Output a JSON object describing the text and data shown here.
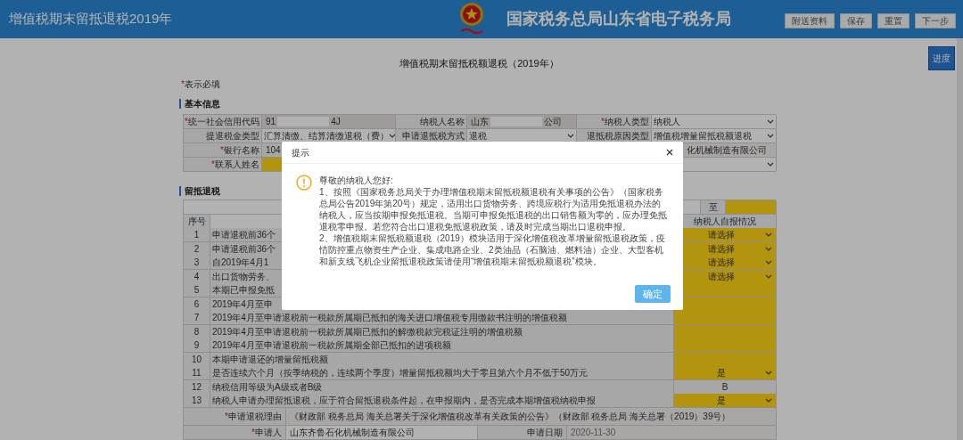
{
  "header": {
    "title": "增值税期末留抵退税2019年",
    "site_name": "国家税务总局山东省电子税务局",
    "buttons": [
      "附送资料",
      "保存",
      "重置",
      "下一步"
    ]
  },
  "page_title": "增值税期末留抵税额退税（2019年）",
  "progress_button": "进度",
  "required_note": {
    "mark": "*",
    "text": "表示必填"
  },
  "basic_info": {
    "title": "基本信息",
    "rows": [
      [
        {
          "kind": "label",
          "mark": "*",
          "text": "统一社会信用代码"
        },
        {
          "kind": "masked",
          "prefix": "91",
          "suffix": "4J"
        },
        {
          "kind": "label",
          "text": "纳税人名称"
        },
        {
          "kind": "masked",
          "prefix": "山东",
          "suffix": "公司"
        },
        {
          "kind": "label",
          "mark": "*",
          "text": "纳税人类型"
        },
        {
          "kind": "select",
          "text": "纳税人"
        }
      ],
      [
        {
          "kind": "label",
          "text": "提退税金类型"
        },
        {
          "kind": "select",
          "text": "汇算清缴、结算清缴退税（费）"
        },
        {
          "kind": "label",
          "text": "申请退抵税方式"
        },
        {
          "kind": "select",
          "text": "退税"
        },
        {
          "kind": "label",
          "text": "退抵税原因类型"
        },
        {
          "kind": "select",
          "text": "增值税增量留抵税额退税"
        }
      ],
      [
        {
          "kind": "label",
          "mark": "*",
          "text": "银行名称"
        },
        {
          "kind": "value",
          "text": "104"
        },
        {
          "kind": "blank"
        },
        {
          "kind": "blank"
        },
        {
          "kind": "blank"
        },
        {
          "kind": "value_tail",
          "text": "化机械制造有限公司"
        }
      ],
      [
        {
          "kind": "label",
          "mark": "*",
          "text": "联系人姓名"
        },
        {
          "kind": "input"
        },
        {
          "kind": "blank"
        },
        {
          "kind": "blank"
        },
        {
          "kind": "blank"
        },
        {
          "kind": "select"
        }
      ]
    ]
  },
  "refund": {
    "title": "留抵退税",
    "period_to": "至",
    "columns": [
      "序号",
      "纳税人自报情况"
    ],
    "rows": [
      {
        "no": "1",
        "text": "申请退税前36个",
        "value": {
          "kind": "select",
          "text": "请选择"
        }
      },
      {
        "no": "2",
        "text": "申请退税前36个",
        "value": {
          "kind": "select",
          "text": "请选择"
        }
      },
      {
        "no": "3",
        "text": "自2019年4月1",
        "value": {
          "kind": "select",
          "text": "请选择"
        }
      },
      {
        "no": "4",
        "text": "出口货物劳务、",
        "value": {
          "kind": "select",
          "text": "请选择"
        }
      },
      {
        "no": "5",
        "text": "本期已申报免抵",
        "value": {
          "kind": "input"
        }
      },
      {
        "no": "6",
        "text": "2019年4月至申",
        "value": {
          "kind": "input"
        }
      },
      {
        "no": "7",
        "text": "2019年4月至申请退税前一税款所属期已抵扣的海关进口增值税专用缴款书注明的增值税额",
        "value": {
          "kind": "input"
        }
      },
      {
        "no": "8",
        "text": "2019年4月至申请退税前一税款所属期已抵扣的解缴税款完税证注明的增值税额",
        "value": {
          "kind": "input"
        }
      },
      {
        "no": "9",
        "text": "2019年4月至申请退税前一税款所属期全部已抵扣的进项税额",
        "value": {
          "kind": "input"
        }
      },
      {
        "no": "10",
        "text": "本期申请退还的增量留抵税额",
        "value": {
          "kind": "input"
        }
      },
      {
        "no": "11",
        "text": "是否连续六个月（按季纳税的，连续两个季度）增量留抵税额均大于零且第六个月不低于50万元",
        "value": {
          "kind": "select",
          "text": "是"
        }
      },
      {
        "no": "12",
        "text": "纳税信用等级为A级或者B级",
        "value": {
          "kind": "value",
          "text": "B"
        }
      },
      {
        "no": "13",
        "text": "纳税人申请办理留抵退税，应于符合留抵退税条件起，在申报期内，是否完成本期增值税纳税申报",
        "value": {
          "kind": "select",
          "text": "是"
        }
      }
    ],
    "reason": {
      "mark": "*",
      "label": "申请退税理由",
      "text": "《财政部 税务总局 海关总署关于深化增值税改革有关政策的公告》（财政部 税务总局 海关总署（2019）39号）"
    },
    "applicant": {
      "mark": "*",
      "label": "申请人",
      "value": "山东齐鲁石化机械制造有限公司",
      "date_label": "申请日期",
      "date": "2020-11-30"
    }
  },
  "dialog": {
    "title": "提示",
    "greeting": "尊敬的纳税人您好:",
    "paragraphs": [
      "1、按照《国家税务总局关于办理增值税期末留抵税额退税有关事项的公告》（国家税务总局公告2019年第20号）规定，适用出口货物劳务、跨境应税行为适用免抵退税办法的纳税人，应当按期申报免抵退税。当期可申报免抵退税的出口销售额为零的，应办理免抵退税零申报。若您符合出口退税免抵退税政策，请及时完成当期出口退税申报。",
      "2、增值税期末留抵税额退税（2019）模块适用于深化增值税改革增量留抵退税政策，疫情防控重点物资生产企业、集成电路企业、2类油品（石脑油、燃料油）企业、大型客机和新支线飞机企业留抵退税政策请使用“增值税期末留抵税额退税”模块。"
    ],
    "button": "确定"
  }
}
